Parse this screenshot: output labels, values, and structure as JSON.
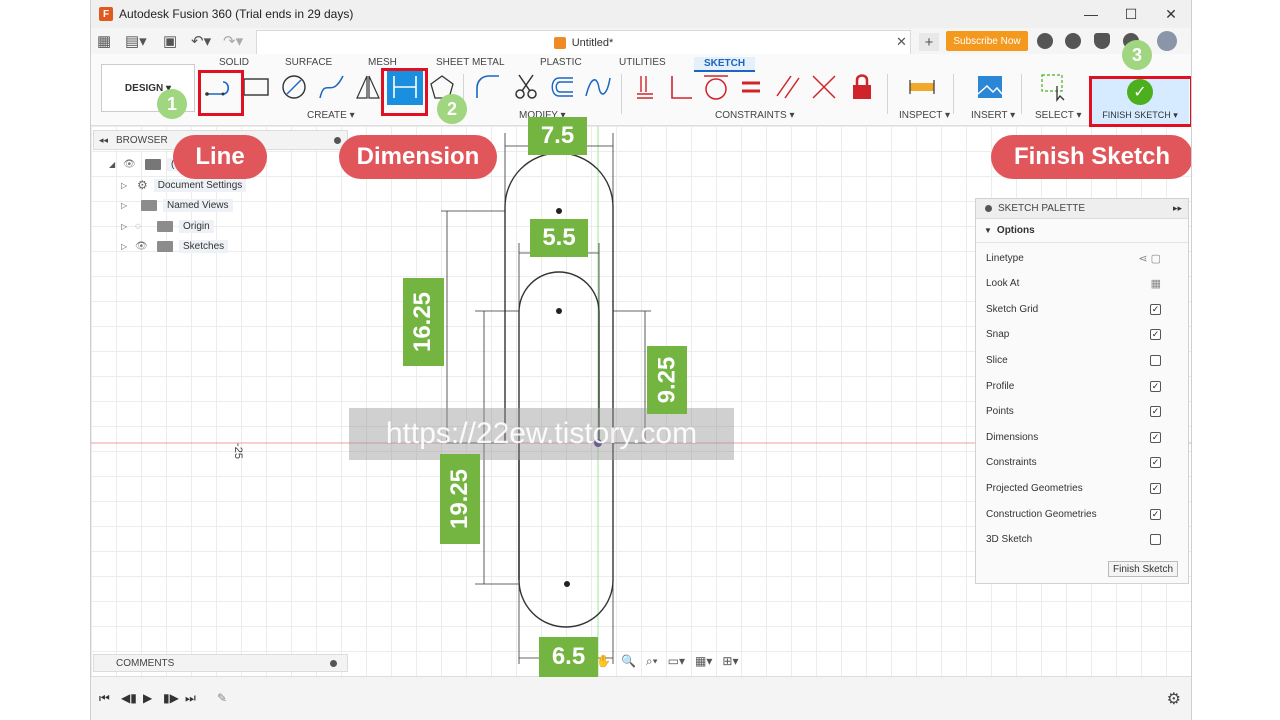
{
  "window": {
    "title": "Autodesk Fusion 360 (Trial ends in 29 days)"
  },
  "appbar": {
    "doc_title": "Untitled*",
    "subscribe_label": "Subscribe Now"
  },
  "ribbon": {
    "tabs": [
      "SOLID",
      "SURFACE",
      "MESH",
      "SHEET METAL",
      "PLASTIC",
      "UTILITIES",
      "SKETCH"
    ],
    "design_label": "DESIGN ▾",
    "groups": {
      "create": "CREATE ▾",
      "modify": "MODIFY ▾",
      "constraints": "CONSTRAINTS ▾",
      "inspect": "INSPECT ▾",
      "insert": "INSERT ▾",
      "select": "SELECT ▾",
      "finish": "FINISH SKETCH ▾"
    }
  },
  "browser": {
    "title": "BROWSER",
    "items": [
      "Document Settings",
      "Named Views",
      "Origin",
      "Sketches"
    ],
    "root_label": "(Un"
  },
  "canvas": {
    "axis_label": "-25",
    "watermark": "https://22ew.tistory.com"
  },
  "palette": {
    "title": "SKETCH PALETTE",
    "section": "Options",
    "rows": [
      {
        "label": "Linetype",
        "kind": "icon",
        "checked": false
      },
      {
        "label": "Look At",
        "kind": "icon",
        "checked": false
      },
      {
        "label": "Sketch Grid",
        "kind": "check",
        "checked": true
      },
      {
        "label": "Snap",
        "kind": "check",
        "checked": true
      },
      {
        "label": "Slice",
        "kind": "check",
        "checked": false
      },
      {
        "label": "Profile",
        "kind": "check",
        "checked": true
      },
      {
        "label": "Points",
        "kind": "check",
        "checked": true
      },
      {
        "label": "Dimensions",
        "kind": "check",
        "checked": true
      },
      {
        "label": "Constraints",
        "kind": "check",
        "checked": true
      },
      {
        "label": "Projected Geometries",
        "kind": "check",
        "checked": true
      },
      {
        "label": "Construction Geometries",
        "kind": "check",
        "checked": true
      },
      {
        "label": "3D Sketch",
        "kind": "check",
        "checked": false
      }
    ],
    "finish_button": "Finish Sketch"
  },
  "comments": {
    "title": "COMMENTS"
  },
  "annotations": {
    "line_label": "Line",
    "dimension_label": "Dimension",
    "finish_label": "Finish Sketch",
    "steps": [
      "1",
      "2",
      "3"
    ],
    "dims": {
      "top_width": "7.5",
      "inner_width": "5.5",
      "bottom_width": "6.5",
      "left_upper": "16.25",
      "left_lower": "19.25",
      "right": "9.25"
    }
  },
  "colors": {
    "annotation_red": "#e01020",
    "pill": "#e0565a",
    "dim_green": "#74b441",
    "step_green": "#9fd67f",
    "accent_blue": "#1a66c2"
  }
}
